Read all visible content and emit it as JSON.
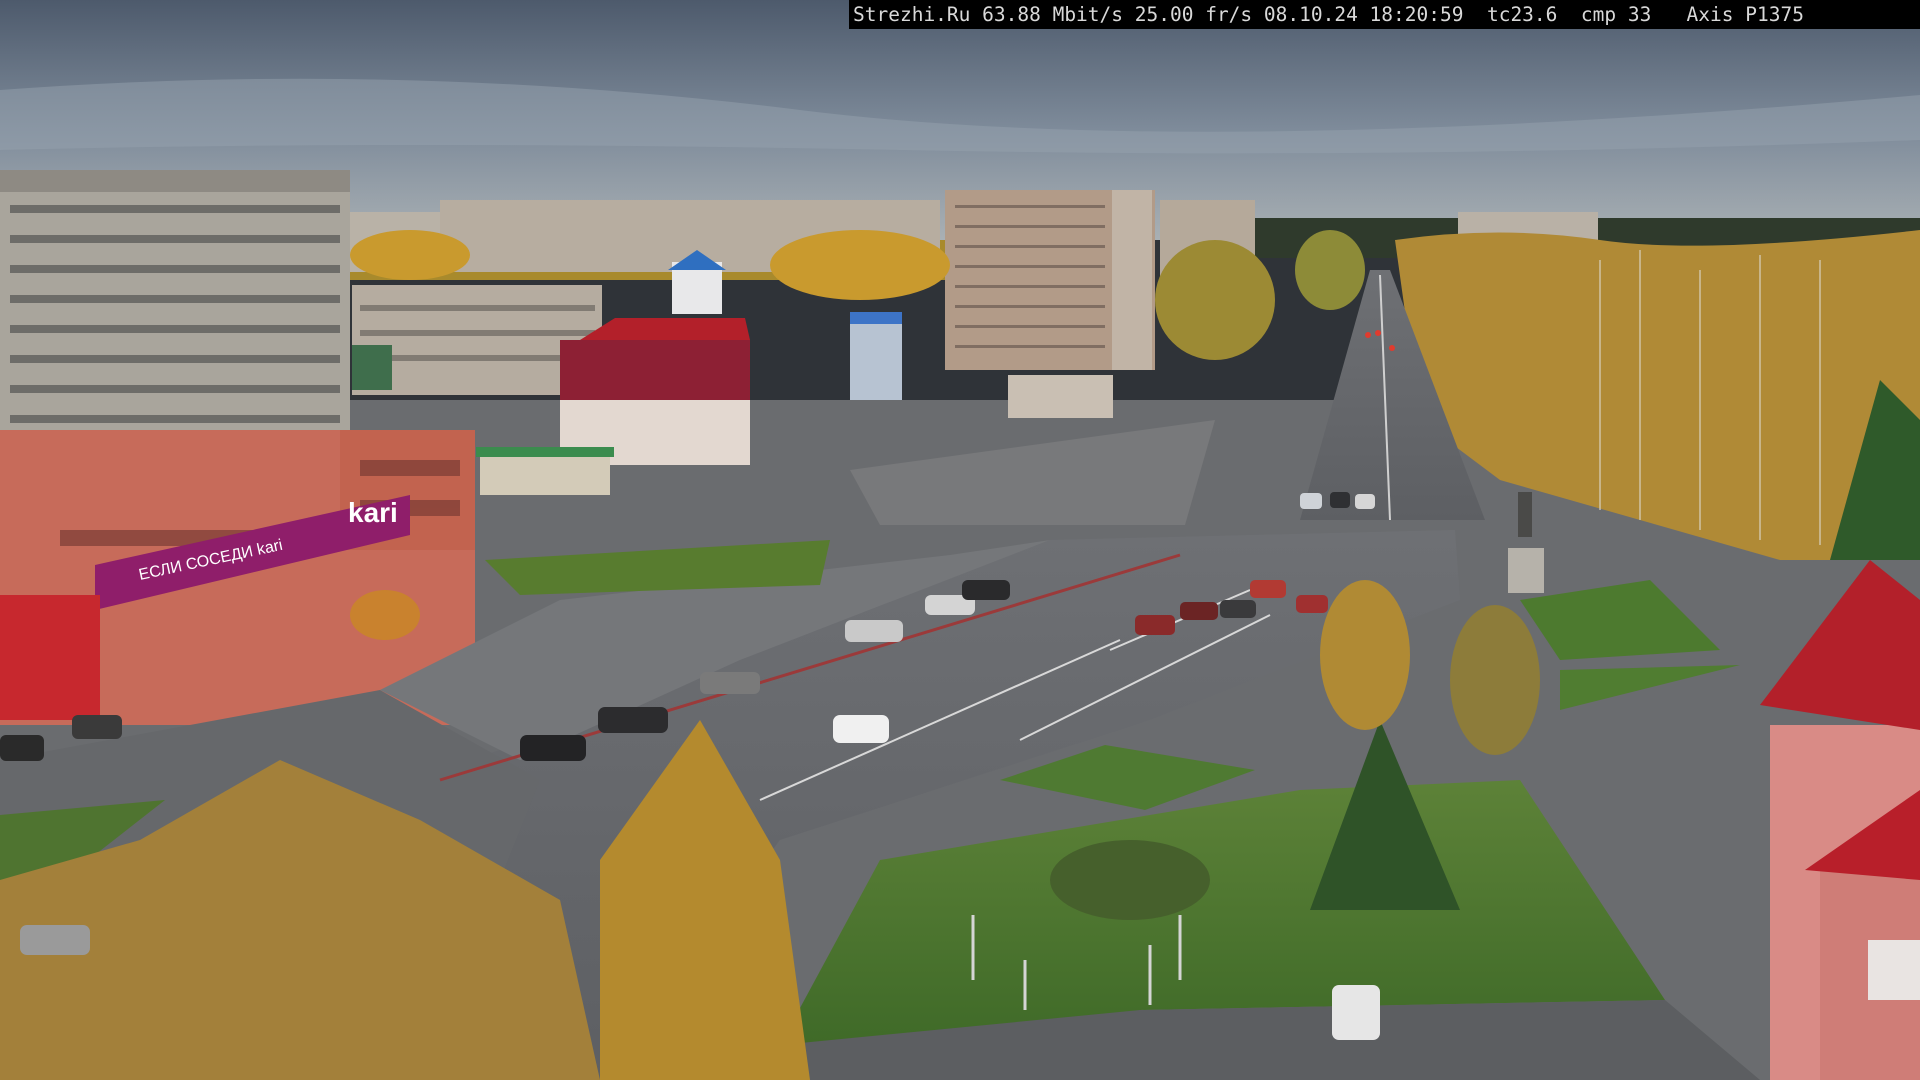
{
  "camera_overlay": {
    "text": "Strezhi.Ru 63.88 Mbit/s 25.00 fr/s 08.10.24 18:20:59  tc23.6  cmp 33   Axis P1375"
  },
  "scene": {
    "storefront_sign": "kari",
    "storefront_banner": "ЕСЛИ СОСЕДИ kari"
  },
  "palette": {
    "sky": "#8a98a8",
    "asphalt": "#6b6d70",
    "grass": "#4f7a32",
    "autumn_foliage": "#c99a2e",
    "kari_accent": "#8f1e6a",
    "roof_red": "#b3202a"
  }
}
